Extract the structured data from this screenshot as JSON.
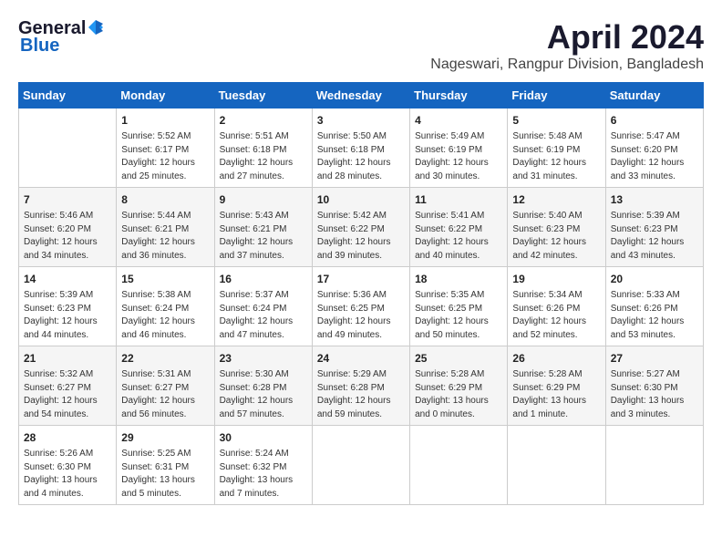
{
  "header": {
    "logo_general": "General",
    "logo_blue": "Blue",
    "month": "April 2024",
    "location": "Nageswari, Rangpur Division, Bangladesh"
  },
  "days_of_week": [
    "Sunday",
    "Monday",
    "Tuesday",
    "Wednesday",
    "Thursday",
    "Friday",
    "Saturday"
  ],
  "weeks": [
    [
      {
        "day": "",
        "content": ""
      },
      {
        "day": "1",
        "content": "Sunrise: 5:52 AM\nSunset: 6:17 PM\nDaylight: 12 hours\nand 25 minutes."
      },
      {
        "day": "2",
        "content": "Sunrise: 5:51 AM\nSunset: 6:18 PM\nDaylight: 12 hours\nand 27 minutes."
      },
      {
        "day": "3",
        "content": "Sunrise: 5:50 AM\nSunset: 6:18 PM\nDaylight: 12 hours\nand 28 minutes."
      },
      {
        "day": "4",
        "content": "Sunrise: 5:49 AM\nSunset: 6:19 PM\nDaylight: 12 hours\nand 30 minutes."
      },
      {
        "day": "5",
        "content": "Sunrise: 5:48 AM\nSunset: 6:19 PM\nDaylight: 12 hours\nand 31 minutes."
      },
      {
        "day": "6",
        "content": "Sunrise: 5:47 AM\nSunset: 6:20 PM\nDaylight: 12 hours\nand 33 minutes."
      }
    ],
    [
      {
        "day": "7",
        "content": "Sunrise: 5:46 AM\nSunset: 6:20 PM\nDaylight: 12 hours\nand 34 minutes."
      },
      {
        "day": "8",
        "content": "Sunrise: 5:44 AM\nSunset: 6:21 PM\nDaylight: 12 hours\nand 36 minutes."
      },
      {
        "day": "9",
        "content": "Sunrise: 5:43 AM\nSunset: 6:21 PM\nDaylight: 12 hours\nand 37 minutes."
      },
      {
        "day": "10",
        "content": "Sunrise: 5:42 AM\nSunset: 6:22 PM\nDaylight: 12 hours\nand 39 minutes."
      },
      {
        "day": "11",
        "content": "Sunrise: 5:41 AM\nSunset: 6:22 PM\nDaylight: 12 hours\nand 40 minutes."
      },
      {
        "day": "12",
        "content": "Sunrise: 5:40 AM\nSunset: 6:23 PM\nDaylight: 12 hours\nand 42 minutes."
      },
      {
        "day": "13",
        "content": "Sunrise: 5:39 AM\nSunset: 6:23 PM\nDaylight: 12 hours\nand 43 minutes."
      }
    ],
    [
      {
        "day": "14",
        "content": "Sunrise: 5:39 AM\nSunset: 6:23 PM\nDaylight: 12 hours\nand 44 minutes."
      },
      {
        "day": "15",
        "content": "Sunrise: 5:38 AM\nSunset: 6:24 PM\nDaylight: 12 hours\nand 46 minutes."
      },
      {
        "day": "16",
        "content": "Sunrise: 5:37 AM\nSunset: 6:24 PM\nDaylight: 12 hours\nand 47 minutes."
      },
      {
        "day": "17",
        "content": "Sunrise: 5:36 AM\nSunset: 6:25 PM\nDaylight: 12 hours\nand 49 minutes."
      },
      {
        "day": "18",
        "content": "Sunrise: 5:35 AM\nSunset: 6:25 PM\nDaylight: 12 hours\nand 50 minutes."
      },
      {
        "day": "19",
        "content": "Sunrise: 5:34 AM\nSunset: 6:26 PM\nDaylight: 12 hours\nand 52 minutes."
      },
      {
        "day": "20",
        "content": "Sunrise: 5:33 AM\nSunset: 6:26 PM\nDaylight: 12 hours\nand 53 minutes."
      }
    ],
    [
      {
        "day": "21",
        "content": "Sunrise: 5:32 AM\nSunset: 6:27 PM\nDaylight: 12 hours\nand 54 minutes."
      },
      {
        "day": "22",
        "content": "Sunrise: 5:31 AM\nSunset: 6:27 PM\nDaylight: 12 hours\nand 56 minutes."
      },
      {
        "day": "23",
        "content": "Sunrise: 5:30 AM\nSunset: 6:28 PM\nDaylight: 12 hours\nand 57 minutes."
      },
      {
        "day": "24",
        "content": "Sunrise: 5:29 AM\nSunset: 6:28 PM\nDaylight: 12 hours\nand 59 minutes."
      },
      {
        "day": "25",
        "content": "Sunrise: 5:28 AM\nSunset: 6:29 PM\nDaylight: 13 hours\nand 0 minutes."
      },
      {
        "day": "26",
        "content": "Sunrise: 5:28 AM\nSunset: 6:29 PM\nDaylight: 13 hours\nand 1 minute."
      },
      {
        "day": "27",
        "content": "Sunrise: 5:27 AM\nSunset: 6:30 PM\nDaylight: 13 hours\nand 3 minutes."
      }
    ],
    [
      {
        "day": "28",
        "content": "Sunrise: 5:26 AM\nSunset: 6:30 PM\nDaylight: 13 hours\nand 4 minutes."
      },
      {
        "day": "29",
        "content": "Sunrise: 5:25 AM\nSunset: 6:31 PM\nDaylight: 13 hours\nand 5 minutes."
      },
      {
        "day": "30",
        "content": "Sunrise: 5:24 AM\nSunset: 6:32 PM\nDaylight: 13 hours\nand 7 minutes."
      },
      {
        "day": "",
        "content": ""
      },
      {
        "day": "",
        "content": ""
      },
      {
        "day": "",
        "content": ""
      },
      {
        "day": "",
        "content": ""
      }
    ]
  ]
}
